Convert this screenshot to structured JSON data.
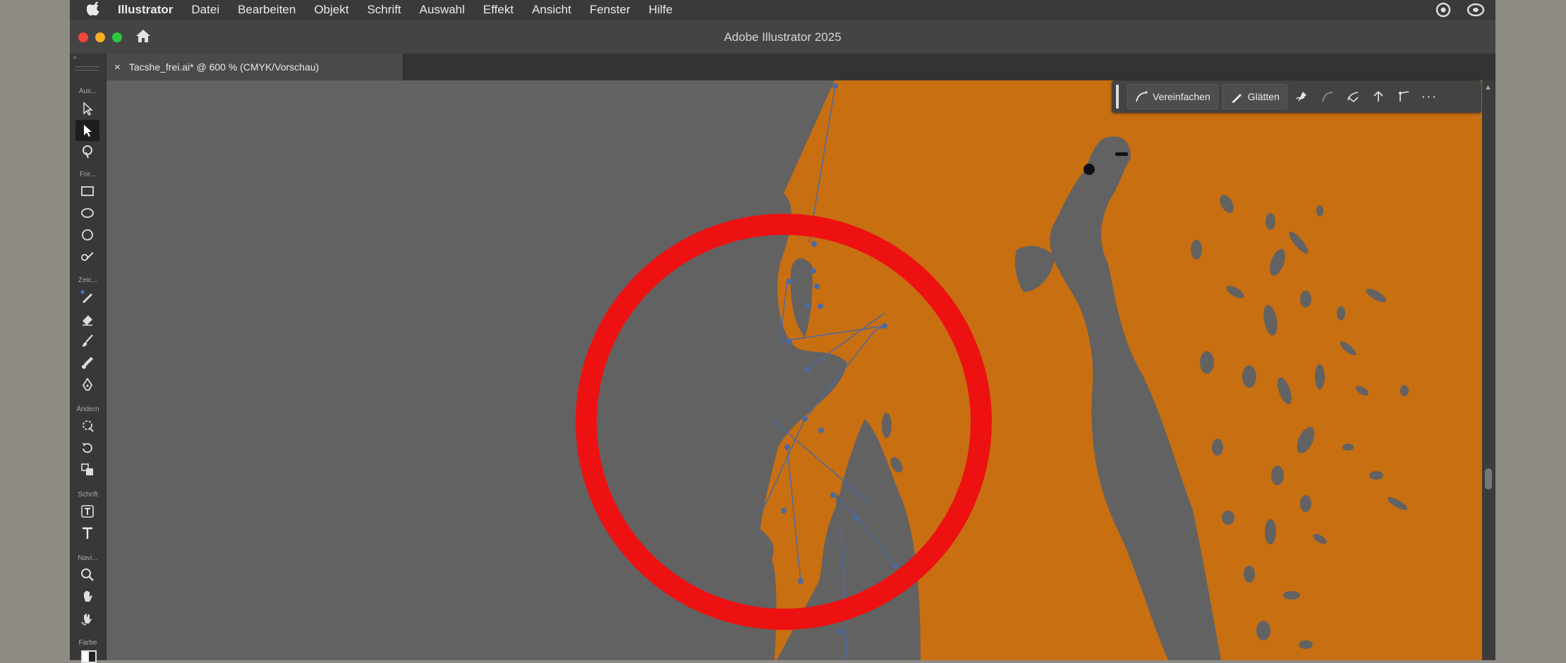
{
  "menubar": {
    "apple": "",
    "items": [
      "Illustrator",
      "Datei",
      "Bearbeiten",
      "Objekt",
      "Schrift",
      "Auswahl",
      "Effekt",
      "Ansicht",
      "Fenster",
      "Hilfe"
    ]
  },
  "window": {
    "title": "Adobe Illustrator 2025",
    "tab_close": "×",
    "tab_label": "Tacshe_frei.ai* @ 600 % (CMYK/Vorschau)"
  },
  "toolbox": {
    "grip": "»",
    "groups": [
      "Aus...",
      "For...",
      "Zeic...",
      "Ändern",
      "Schrift",
      "Navi...",
      "Farbe"
    ]
  },
  "context_bar": {
    "simplify_label": "Vereinfachen",
    "smooth_label": "Glätten",
    "more": "···"
  },
  "colors": {
    "artwork_orange": "#c86f12",
    "canvas_gray": "#626262",
    "highlight_red": "#ee1111",
    "anchor_blue": "#4b6aa3"
  }
}
